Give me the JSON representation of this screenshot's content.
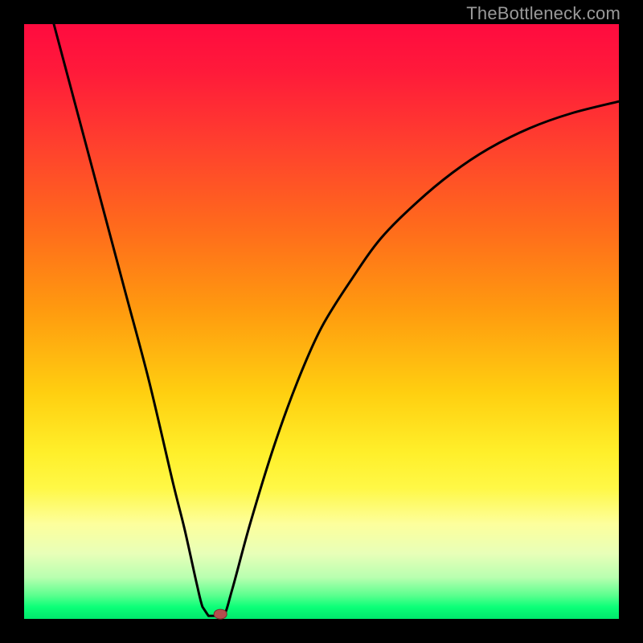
{
  "watermark": "TheBottleneck.com",
  "colors": {
    "background": "#000000",
    "curve": "#000000",
    "marker_fill": "#b34d4d",
    "marker_stroke": "#7a2f2f",
    "gradient_top": "#ff0b3f",
    "gradient_bottom": "#00e86c"
  },
  "chart_data": {
    "type": "line",
    "title": "",
    "xlabel": "",
    "ylabel": "",
    "xlim": [
      0,
      100
    ],
    "ylim": [
      0,
      100
    ],
    "x": [
      5,
      9,
      13,
      17,
      21,
      25,
      27,
      29,
      30,
      31,
      31.5,
      33.5,
      35,
      38,
      42,
      46,
      50,
      55,
      60,
      66,
      72,
      78,
      85,
      92,
      100
    ],
    "y": [
      100,
      85,
      70,
      55,
      40,
      23,
      15,
      6,
      2,
      0.5,
      0.5,
      0.5,
      5,
      16,
      29,
      40,
      49,
      57,
      64,
      70,
      75,
      79,
      82.5,
      85,
      87
    ],
    "flat_bottom": {
      "x0": 30,
      "x1": 33.5,
      "y": 0.5
    },
    "marker": {
      "x": 33,
      "y": 0.8
    },
    "notes": "V-shaped curve: left branch nearly linear descent from top-left; small flat segment at the bottom (~x 30–33.5); right branch rises with decreasing slope (concave) toward upper-right. Values are estimates read off the image; no axes or tick labels are present."
  }
}
